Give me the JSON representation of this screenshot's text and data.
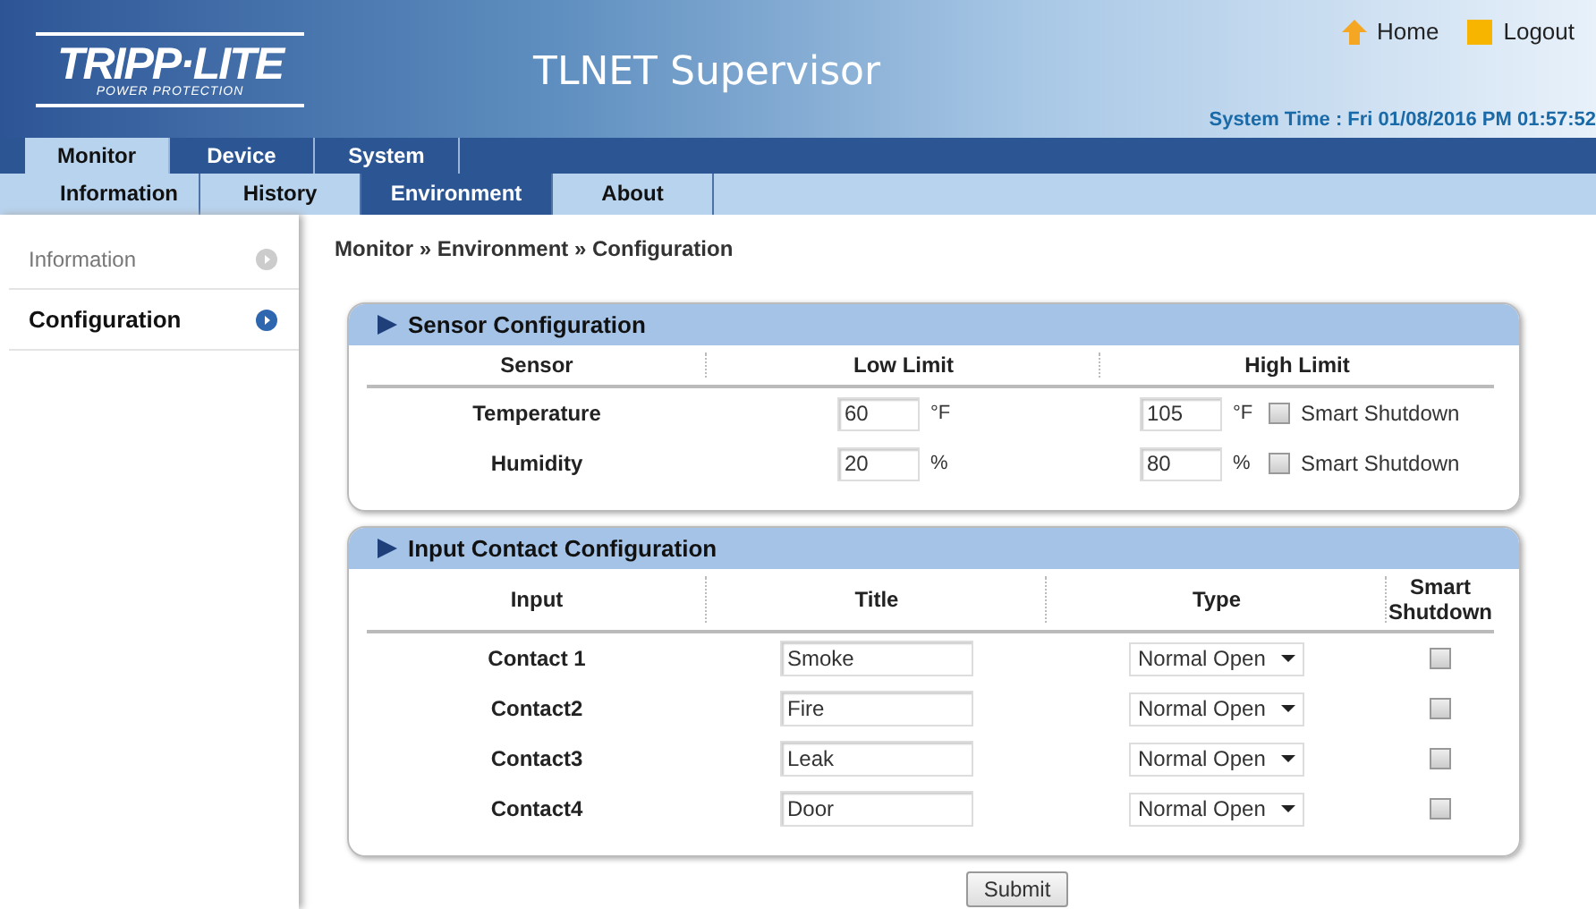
{
  "logo": {
    "brand": "TRIPP·LITE",
    "tagline": "POWER PROTECTION"
  },
  "app_title": "TLNET Supervisor",
  "header_links": [
    {
      "kind": "home",
      "label": "Home"
    },
    {
      "kind": "logout",
      "label": "Logout"
    }
  ],
  "system_time": "System Time : Fri 01/08/2016 PM 01:57:52",
  "main_tabs": [
    {
      "label": "Monitor",
      "selected": true
    },
    {
      "label": "Device",
      "selected": false
    },
    {
      "label": "System",
      "selected": false
    }
  ],
  "sub_tabs": [
    {
      "label": "Information",
      "selected": false
    },
    {
      "label": "History",
      "selected": false
    },
    {
      "label": "Environment",
      "selected": true
    },
    {
      "label": "About",
      "selected": false
    }
  ],
  "sidebar": {
    "items": [
      {
        "label": "Information",
        "selected": false
      },
      {
        "label": "Configuration",
        "selected": true
      }
    ]
  },
  "breadcrumb": "Monitor » Environment » Configuration",
  "sensor_panel": {
    "title": "Sensor Configuration",
    "columns": [
      "Sensor",
      "Low Limit",
      "High Limit"
    ],
    "rows": [
      {
        "name": "Temperature",
        "low": "60",
        "low_unit": "°F",
        "high": "105",
        "high_unit": "°F",
        "shutdown_label": "Smart Shutdown",
        "checked": false
      },
      {
        "name": "Humidity",
        "low": "20",
        "low_unit": "%",
        "high": "80",
        "high_unit": "%",
        "shutdown_label": "Smart Shutdown",
        "checked": false
      }
    ]
  },
  "contact_panel": {
    "title": "Input Contact Configuration",
    "columns": [
      "Input",
      "Title",
      "Type",
      "Smart Shutdown"
    ],
    "rows": [
      {
        "input": "Contact 1",
        "title": "Smoke",
        "type": "Normal Open",
        "checked": false
      },
      {
        "input": "Contact2",
        "title": "Fire",
        "type": "Normal Open",
        "checked": false
      },
      {
        "input": "Contact3",
        "title": "Leak",
        "type": "Normal Open",
        "checked": false
      },
      {
        "input": "Contact4",
        "title": "Door",
        "type": "Normal Open",
        "checked": false
      }
    ]
  },
  "submit_button": "Submit"
}
